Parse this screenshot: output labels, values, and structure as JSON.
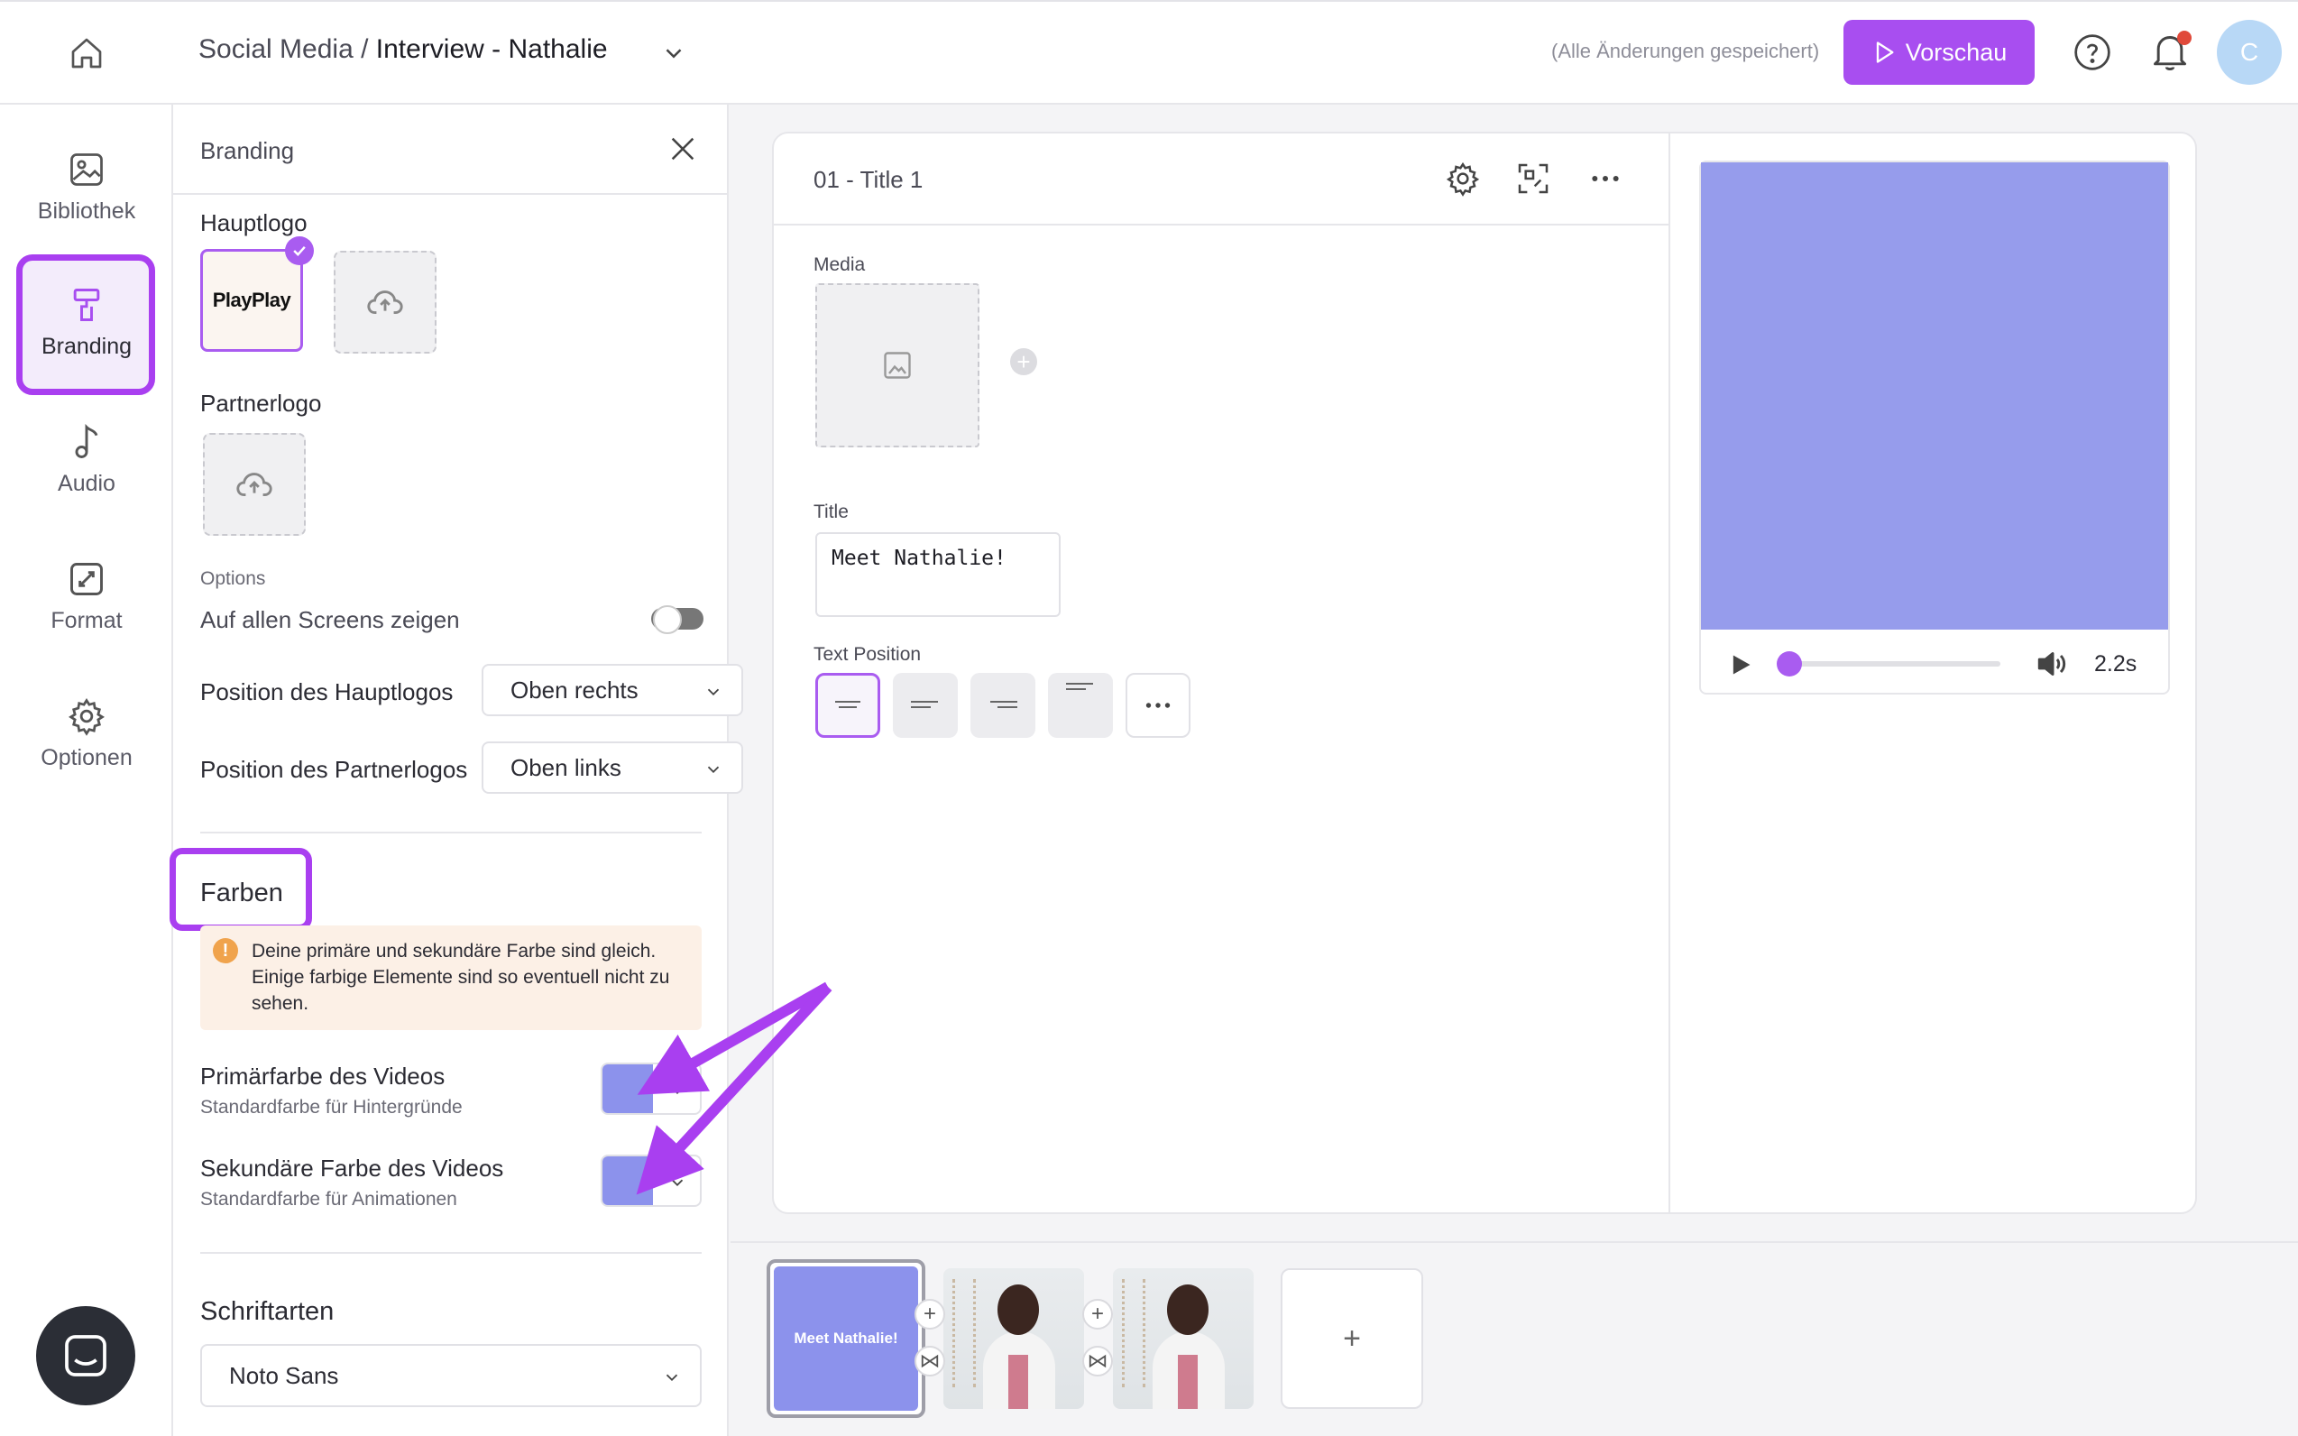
{
  "header": {
    "breadcrumb_parent": "Social Media",
    "breadcrumb_sep": " / ",
    "breadcrumb_current": "Interview - Nathalie",
    "save_status": "(Alle Änderungen gespeichert)",
    "preview_label": "Vorschau",
    "avatar_initial": "C"
  },
  "rail": {
    "items": [
      {
        "label": "Bibliothek",
        "icon": "image-icon"
      },
      {
        "label": "Branding",
        "icon": "paint-roller-icon"
      },
      {
        "label": "Audio",
        "icon": "music-note-icon"
      },
      {
        "label": "Format",
        "icon": "resize-icon"
      },
      {
        "label": "Optionen",
        "icon": "gear-icon"
      }
    ]
  },
  "panel": {
    "title": "Branding",
    "main_logo_label": "Hauptlogo",
    "main_logo_text": "PlayPlay",
    "partner_logo_label": "Partnerlogo",
    "options_label": "Options",
    "show_all_label": "Auf allen Screens zeigen",
    "main_logo_position_label": "Position des Hauptlogos",
    "main_logo_position_value": "Oben rechts",
    "partner_logo_position_label": "Position des Partnerlogos",
    "partner_logo_position_value": "Oben links",
    "colors_heading": "Farben",
    "warning_text": "Deine primäre und sekundäre Farbe sind gleich. Einige farbige Elemente sind so eventuell nicht zu sehen.",
    "primary_color_label": "Primärfarbe des Videos",
    "primary_color_sub": "Standardfarbe für Hintergründe",
    "secondary_color_label": "Sekundäre Farbe des Videos",
    "secondary_color_sub": "Standardfarbe für Animationen",
    "fonts_heading": "Schriftarten",
    "font_value": "Noto Sans",
    "primary_color": "#8c92ec",
    "secondary_color": "#8c92ec"
  },
  "editor": {
    "scene_title": "01 - Title 1",
    "media_label": "Media",
    "title_label": "Title",
    "title_value": "Meet Nathalie!",
    "text_position_label": "Text Position"
  },
  "player": {
    "duration": "2.2s",
    "screen_color": "#969cec"
  },
  "timeline": {
    "scene1_text": "Meet Nathalie!"
  },
  "colors": {
    "accent": "#a84ef0",
    "highlight": "#a93ff0"
  }
}
